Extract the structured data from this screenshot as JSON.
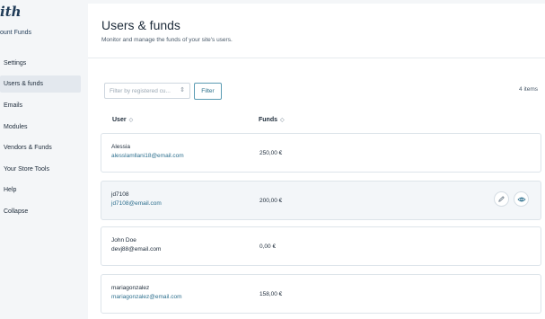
{
  "sidebar": {
    "logo": "ith",
    "brand": "ount Funds",
    "items": [
      {
        "label": "Settings"
      },
      {
        "label": "Users & funds"
      },
      {
        "label": "Emails"
      },
      {
        "label": "Modules"
      },
      {
        "label": "Vendors & Funds"
      },
      {
        "label": "Your Store Tools"
      },
      {
        "label": "Help"
      },
      {
        "label": "Collapse"
      }
    ],
    "active_index": 1
  },
  "main": {
    "title": "Users & funds",
    "description": "Monitor and manage the funds of your site's users.",
    "filter": {
      "placeholder": "Filter by registered cu...",
      "button_label": "Filter"
    },
    "items_count": "4 items",
    "columns": [
      {
        "label": "User",
        "sort_icon": "sort-icon"
      },
      {
        "label": "Funds",
        "sort_icon": "sort-icon"
      }
    ],
    "rows": [
      {
        "name": "Alessia",
        "email": "alesslamllani18@email.com",
        "funds": "250,00 €"
      },
      {
        "name": "jd7108",
        "email": "jd7108@email.com",
        "funds": "200,00 €"
      },
      {
        "name": "John Doe",
        "email": "devj88@email.com",
        "funds": "0,00 €"
      },
      {
        "name": "mariagonzalez",
        "email": "mariagonzalez@email.com",
        "funds": "158,00 €"
      }
    ],
    "row_actions": [
      {
        "icon": "pencil-icon"
      },
      {
        "icon": "eye-icon"
      }
    ]
  },
  "colors": {
    "accent": "#2d6f8e",
    "panel_bg": "#ffffff",
    "page_bg": "#f4f6f8",
    "active_nav_bg": "#e3e8ee"
  }
}
